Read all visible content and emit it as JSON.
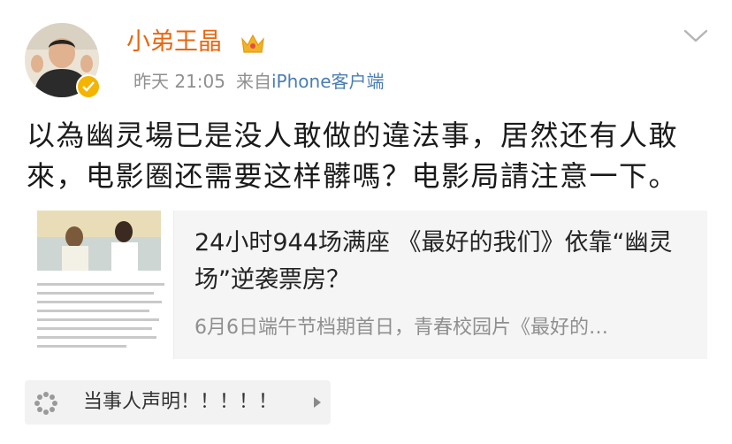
{
  "post": {
    "username": "小弟王晶",
    "time": "昨天 21:05",
    "source_prefix": "来自",
    "source_client": "iPhone客户端",
    "text": "以為幽灵場已是没人敢做的違法事，居然还有人敢來，电影圈还需要这样髒嗎？电影局請注意一下。"
  },
  "card": {
    "title": "24小时944场满座 《最好的我们》依靠“幽灵场”逆袭票房？",
    "description": "6月6日端午节档期首日，青春校园片《最好的…"
  },
  "topic": {
    "label": "当事人声明！！！！！"
  },
  "icons": {
    "avatar": "avatar",
    "verified": "verified-badge-icon",
    "member": "crown-icon",
    "menu": "chevron-down-icon",
    "topic": "loading-icon",
    "arrow": "triangle-right-icon"
  },
  "colors": {
    "username": "#e9670f",
    "client_link": "#4a7db3",
    "meta": "#8f8f8f",
    "verified": "#f4b400",
    "card_bg": "#f5f5f5"
  }
}
